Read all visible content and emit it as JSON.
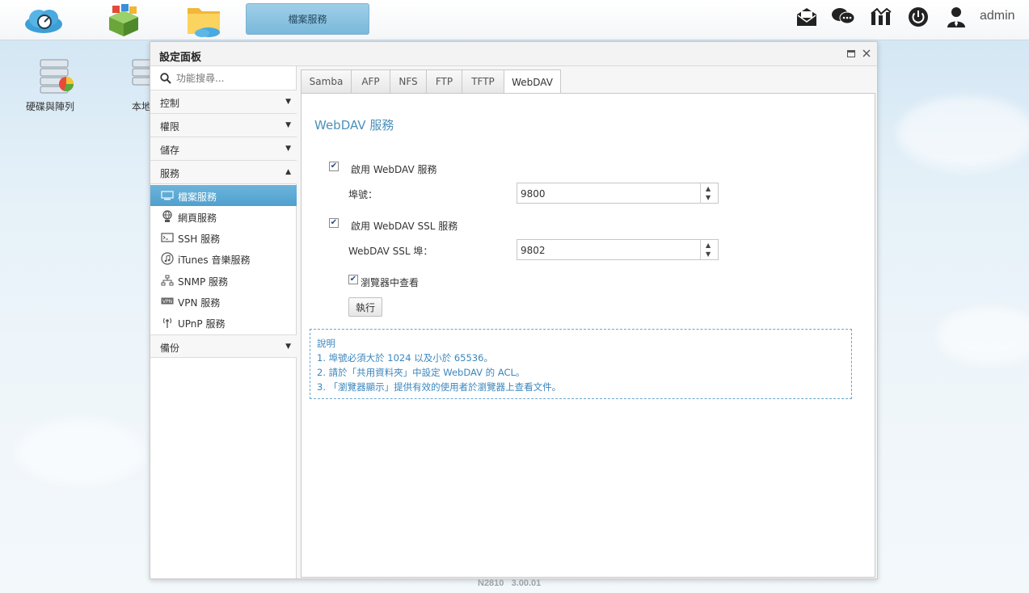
{
  "taskbar": {
    "apps": [
      {
        "icon": "cloud-dashboard-icon"
      },
      {
        "icon": "app-center-icon"
      },
      {
        "icon": "file-folder-icon"
      }
    ],
    "active_window": "檔案服務",
    "right_icons": [
      "mail-icon",
      "chat-icon",
      "network-icon",
      "power-icon",
      "user-icon"
    ],
    "username": "admin"
  },
  "desktop": {
    "icons": [
      {
        "label": "硬碟與陣列",
        "icon": "disk-raid-icon"
      },
      {
        "label": "本地",
        "icon": "local-backup-icon"
      }
    ]
  },
  "window": {
    "title": "設定面板",
    "controls": [
      "maximize-icon",
      "close-icon"
    ]
  },
  "sidebar": {
    "search_placeholder": "功能搜尋...",
    "categories": {
      "control": "控制",
      "privilege": "權限",
      "storage": "儲存",
      "service": "服務",
      "backup": "備份"
    },
    "service_items": [
      {
        "label": "檔案服務",
        "icon": "file-service-icon",
        "active": true
      },
      {
        "label": "網頁服務",
        "icon": "web-service-icon"
      },
      {
        "label": "SSH 服務",
        "icon": "ssh-service-icon"
      },
      {
        "label": "iTunes 音樂服務",
        "icon": "itunes-service-icon"
      },
      {
        "label": "SNMP 服務",
        "icon": "snmp-service-icon"
      },
      {
        "label": "VPN 服務",
        "icon": "vpn-service-icon"
      },
      {
        "label": "UPnP 服務",
        "icon": "upnp-service-icon"
      }
    ]
  },
  "tabs": [
    "Samba",
    "AFP",
    "NFS",
    "FTP",
    "TFTP",
    "WebDAV"
  ],
  "active_tab": "WebDAV",
  "webdav": {
    "title": "WebDAV 服務",
    "enable_label": "啟用 WebDAV 服務",
    "enable_checked": true,
    "port_label": "埠號：",
    "port_value": "9800",
    "enable_ssl_label": "啟用 WebDAV SSL 服務",
    "enable_ssl_checked": true,
    "ssl_port_label": "WebDAV SSL 埠：",
    "ssl_port_value": "9802",
    "browser_view_label": "瀏覽器中查看",
    "browser_view_checked": true,
    "apply_label": "執行"
  },
  "notes": {
    "heading": "說明",
    "lines": [
      "1. 埠號必須大於 1024 以及小於 65536。",
      "2. 請於「共用資料夾」中設定 WebDAV 的 ACL。",
      "3. 「瀏覽器顯示」提供有效的使用者於瀏覽器上查看文件。"
    ]
  },
  "footer": {
    "model": "N2810",
    "version": "3.00.01"
  }
}
